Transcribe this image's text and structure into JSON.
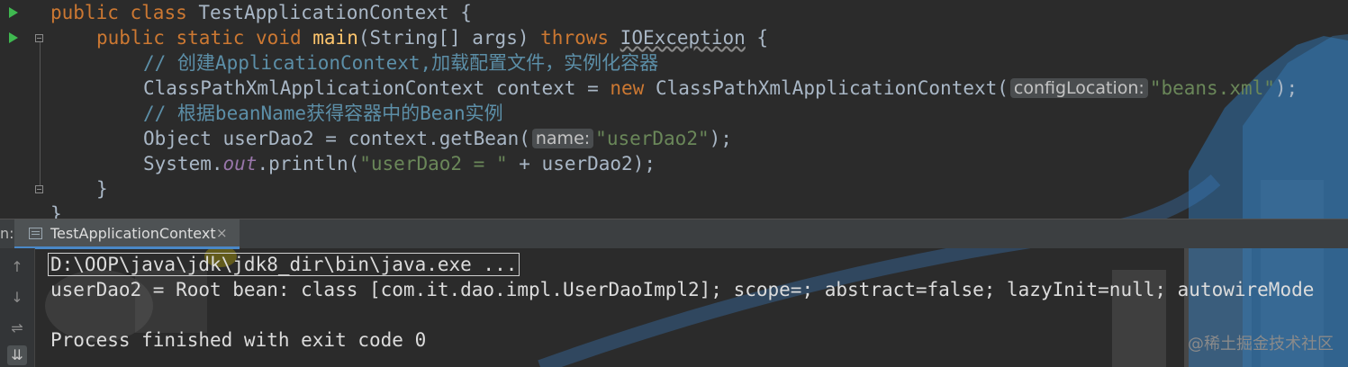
{
  "editor": {
    "lines": [
      {
        "kw1": "public",
        "kw2": "class",
        "name": "TestApplicationContext",
        "brace": "{"
      },
      {
        "kw1": "public",
        "kw2": "static",
        "kw3": "void",
        "method": "main",
        "params": "(String[] args)",
        "throws": "throws",
        "exception": "IOException",
        "brace": "{"
      },
      {
        "comment": "// 创建ApplicationContext,加载配置文件，实例化容器"
      },
      {
        "type": "ClassPathXmlApplicationContext context = ",
        "kw": "new",
        "ctor": "ClassPathXmlApplicationContext(",
        "hint": "configLocation:",
        "string": "\"beans.xml\"",
        "end": ");"
      },
      {
        "comment": "// 根据beanName获得容器中的Bean实例"
      },
      {
        "type": "Object userDao2 = context.getBean(",
        "hint": "name:",
        "string": "\"userDao2\"",
        "end": ");"
      },
      {
        "prefix": "System.",
        "field": "out",
        "call": ".println(",
        "string": "\"userDao2 = \"",
        "end": " + userDao2);"
      },
      {
        "brace": "}"
      },
      {
        "brace": "}"
      }
    ]
  },
  "run": {
    "tabbar_label": "n:",
    "tab_label": "TestApplicationContext",
    "tab_close": "×",
    "tools": {
      "up": "↑",
      "down": "↓",
      "wrap": "⇌",
      "scroll_end": "⇊"
    },
    "output": {
      "line1": "D:\\OOP\\java\\jdk\\jdk8_dir\\bin\\java.exe ...",
      "line2": "userDao2 = Root bean: class [com.it.dao.impl.UserDaoImpl2]; scope=; abstract=false; lazyInit=null; autowireMode",
      "line3": "Process finished with exit code 0"
    }
  },
  "watermark": "@稀土掘金技术社区"
}
